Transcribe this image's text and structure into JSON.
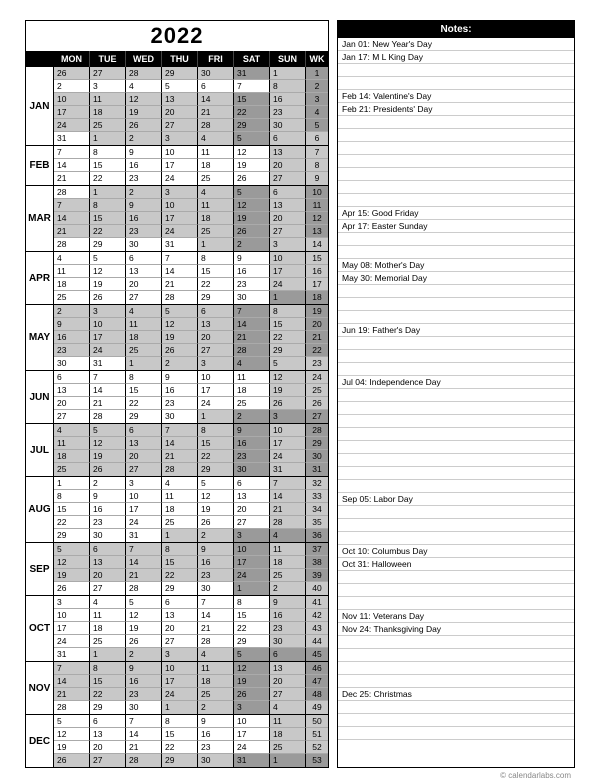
{
  "year": "2022",
  "day_headers": [
    "MON",
    "TUE",
    "WED",
    "THU",
    "FRI",
    "SAT",
    "SUN",
    "WK"
  ],
  "notes_header": "Notes:",
  "footer": "© calendarlabs.com",
  "months": [
    {
      "label": "JAN",
      "weeks": [
        {
          "d": [
            26,
            27,
            28,
            29,
            30,
            31,
            1
          ],
          "wk": 1,
          "gd": [
            0,
            1,
            2,
            3,
            4
          ],
          "gw": true,
          "gwk": true,
          "dw": [
            5
          ]
        },
        {
          "d": [
            2,
            3,
            4,
            5,
            6,
            7,
            8
          ],
          "wk": 2,
          "gd": [],
          "gw": true,
          "gwk": true,
          "dw": []
        },
        {
          "d": [
            10,
            11,
            12,
            13,
            14,
            15,
            16
          ],
          "wk": 3,
          "gd": [
            0,
            1,
            2,
            3,
            4
          ],
          "gw": true,
          "gwk": true,
          "dw": [
            5
          ]
        },
        {
          "d": [
            17,
            18,
            19,
            20,
            21,
            22,
            23
          ],
          "wk": 4,
          "gd": [
            0,
            1,
            2,
            3,
            4
          ],
          "gw": true,
          "gwk": true,
          "dw": [
            5
          ]
        },
        {
          "d": [
            24,
            25,
            26,
            27,
            28,
            29,
            30
          ],
          "wk": 5,
          "gd": [
            0,
            1,
            2,
            3,
            4
          ],
          "gw": true,
          "gwk": true,
          "dw": [
            5
          ]
        },
        {
          "d": [
            31,
            1,
            2,
            3,
            4,
            5,
            6
          ],
          "wk": 6,
          "gd": [
            1,
            2,
            3,
            4
          ],
          "gw": true,
          "gwk": false,
          "dw": [
            5
          ]
        }
      ]
    },
    {
      "label": "FEB",
      "weeks": [
        {
          "d": [
            7,
            8,
            9,
            10,
            11,
            12,
            13
          ],
          "wk": 7,
          "gd": [],
          "gw": true,
          "gwk": false,
          "dw": []
        },
        {
          "d": [
            14,
            15,
            16,
            17,
            18,
            19,
            20
          ],
          "wk": 8,
          "gd": [],
          "gw": true,
          "gwk": false,
          "dw": []
        },
        {
          "d": [
            21,
            22,
            23,
            24,
            25,
            26,
            27
          ],
          "wk": 9,
          "gd": [],
          "gw": true,
          "gwk": false,
          "dw": []
        }
      ]
    },
    {
      "label": "MAR",
      "weeks": [
        {
          "d": [
            28,
            1,
            2,
            3,
            4,
            5,
            6
          ],
          "wk": 10,
          "gd": [
            1,
            2,
            3,
            4
          ],
          "gw": true,
          "gwk": true,
          "dw": [
            5
          ]
        },
        {
          "d": [
            7,
            8,
            9,
            10,
            11,
            12,
            13
          ],
          "wk": 11,
          "gd": [
            0,
            1,
            2,
            3,
            4
          ],
          "gw": true,
          "gwk": true,
          "dw": [
            5
          ]
        },
        {
          "d": [
            14,
            15,
            16,
            17,
            18,
            19,
            20
          ],
          "wk": 12,
          "gd": [
            0,
            1,
            2,
            3,
            4
          ],
          "gw": true,
          "gwk": true,
          "dw": [
            5
          ]
        },
        {
          "d": [
            21,
            22,
            23,
            24,
            25,
            26,
            27
          ],
          "wk": 13,
          "gd": [
            0,
            1,
            2,
            3,
            4
          ],
          "gw": true,
          "gwk": true,
          "dw": [
            5
          ]
        },
        {
          "d": [
            28,
            29,
            30,
            31,
            1,
            2,
            3
          ],
          "wk": 14,
          "gd": [
            4
          ],
          "gw": true,
          "gwk": false,
          "dw": [
            5
          ]
        }
      ]
    },
    {
      "label": "APR",
      "weeks": [
        {
          "d": [
            4,
            5,
            6,
            7,
            8,
            9,
            10
          ],
          "wk": 15,
          "gd": [],
          "gw": true,
          "gwk": false,
          "dw": []
        },
        {
          "d": [
            11,
            12,
            13,
            14,
            15,
            16,
            17
          ],
          "wk": 16,
          "gd": [],
          "gw": true,
          "gwk": false,
          "dw": []
        },
        {
          "d": [
            18,
            19,
            20,
            21,
            22,
            23,
            24
          ],
          "wk": 17,
          "gd": [],
          "gw": true,
          "gwk": false,
          "dw": []
        },
        {
          "d": [
            25,
            26,
            27,
            28,
            29,
            30,
            1
          ],
          "wk": 18,
          "gd": [],
          "gw": true,
          "gwk": true,
          "dw": [
            6
          ]
        }
      ]
    },
    {
      "label": "MAY",
      "weeks": [
        {
          "d": [
            2,
            3,
            4,
            5,
            6,
            7,
            8
          ],
          "wk": 19,
          "gd": [
            0,
            1,
            2,
            3,
            4
          ],
          "gw": true,
          "gwk": true,
          "dw": [
            5
          ]
        },
        {
          "d": [
            9,
            10,
            11,
            12,
            13,
            14,
            15
          ],
          "wk": 20,
          "gd": [
            0,
            1,
            2,
            3,
            4
          ],
          "gw": true,
          "gwk": true,
          "dw": [
            5
          ]
        },
        {
          "d": [
            16,
            17,
            18,
            19,
            20,
            21,
            22
          ],
          "wk": 21,
          "gd": [
            0,
            1,
            2,
            3,
            4
          ],
          "gw": true,
          "gwk": true,
          "dw": [
            5
          ]
        },
        {
          "d": [
            23,
            24,
            25,
            26,
            27,
            28,
            29
          ],
          "wk": 22,
          "gd": [
            0,
            1,
            2,
            3,
            4
          ],
          "gw": true,
          "gwk": true,
          "dw": [
            5
          ]
        },
        {
          "d": [
            30,
            31,
            1,
            2,
            3,
            4,
            5
          ],
          "wk": 23,
          "gd": [
            2,
            3,
            4
          ],
          "gw": true,
          "gwk": false,
          "dw": [
            5
          ]
        }
      ]
    },
    {
      "label": "JUN",
      "weeks": [
        {
          "d": [
            6,
            7,
            8,
            9,
            10,
            11,
            12
          ],
          "wk": 24,
          "gd": [],
          "gw": true,
          "gwk": false,
          "dw": []
        },
        {
          "d": [
            13,
            14,
            15,
            16,
            17,
            18,
            19
          ],
          "wk": 25,
          "gd": [],
          "gw": true,
          "gwk": false,
          "dw": []
        },
        {
          "d": [
            20,
            21,
            22,
            23,
            24,
            25,
            26
          ],
          "wk": 26,
          "gd": [],
          "gw": true,
          "gwk": false,
          "dw": []
        },
        {
          "d": [
            27,
            28,
            29,
            30,
            1,
            2,
            3
          ],
          "wk": 27,
          "gd": [
            4
          ],
          "gw": true,
          "gwk": true,
          "dw": [
            5,
            6
          ]
        }
      ]
    },
    {
      "label": "JUL",
      "weeks": [
        {
          "d": [
            4,
            5,
            6,
            7,
            8,
            9,
            10
          ],
          "wk": 28,
          "gd": [
            0,
            1,
            2,
            3,
            4
          ],
          "gw": true,
          "gwk": true,
          "dw": [
            5
          ]
        },
        {
          "d": [
            11,
            12,
            13,
            14,
            15,
            16,
            17
          ],
          "wk": 29,
          "gd": [
            0,
            1,
            2,
            3,
            4
          ],
          "gw": true,
          "gwk": true,
          "dw": [
            5
          ]
        },
        {
          "d": [
            18,
            19,
            20,
            21,
            22,
            23,
            24
          ],
          "wk": 30,
          "gd": [
            0,
            1,
            2,
            3,
            4
          ],
          "gw": true,
          "gwk": true,
          "dw": [
            5
          ]
        },
        {
          "d": [
            25,
            26,
            27,
            28,
            29,
            30,
            31
          ],
          "wk": 31,
          "gd": [
            0,
            1,
            2,
            3,
            4
          ],
          "gw": true,
          "gwk": true,
          "dw": [
            5
          ]
        }
      ]
    },
    {
      "label": "AUG",
      "weeks": [
        {
          "d": [
            1,
            2,
            3,
            4,
            5,
            6,
            7
          ],
          "wk": 32,
          "gd": [],
          "gw": true,
          "gwk": false,
          "dw": []
        },
        {
          "d": [
            8,
            9,
            10,
            11,
            12,
            13,
            14
          ],
          "wk": 33,
          "gd": [],
          "gw": true,
          "gwk": false,
          "dw": []
        },
        {
          "d": [
            15,
            16,
            17,
            18,
            19,
            20,
            21
          ],
          "wk": 34,
          "gd": [],
          "gw": true,
          "gwk": false,
          "dw": []
        },
        {
          "d": [
            22,
            23,
            24,
            25,
            26,
            27,
            28
          ],
          "wk": 35,
          "gd": [],
          "gw": true,
          "gwk": false,
          "dw": []
        },
        {
          "d": [
            29,
            30,
            31,
            1,
            2,
            3,
            4
          ],
          "wk": 36,
          "gd": [
            3,
            4
          ],
          "gw": true,
          "gwk": true,
          "dw": [
            5,
            6
          ]
        }
      ]
    },
    {
      "label": "SEP",
      "weeks": [
        {
          "d": [
            5,
            6,
            7,
            8,
            9,
            10,
            11
          ],
          "wk": 37,
          "gd": [
            0,
            1,
            2,
            3,
            4
          ],
          "gw": true,
          "gwk": true,
          "dw": [
            5
          ]
        },
        {
          "d": [
            12,
            13,
            14,
            15,
            16,
            17,
            18
          ],
          "wk": 38,
          "gd": [
            0,
            1,
            2,
            3,
            4
          ],
          "gw": true,
          "gwk": true,
          "dw": [
            5
          ]
        },
        {
          "d": [
            19,
            20,
            21,
            22,
            23,
            24,
            25
          ],
          "wk": 39,
          "gd": [
            0,
            1,
            2,
            3,
            4
          ],
          "gw": true,
          "gwk": true,
          "dw": [
            5
          ]
        },
        {
          "d": [
            26,
            27,
            28,
            29,
            30,
            1,
            2
          ],
          "wk": 40,
          "gd": [],
          "gw": true,
          "gwk": false,
          "dw": [
            5
          ]
        }
      ]
    },
    {
      "label": "OCT",
      "weeks": [
        {
          "d": [
            3,
            4,
            5,
            6,
            7,
            8,
            9
          ],
          "wk": 41,
          "gd": [],
          "gw": true,
          "gwk": false,
          "dw": []
        },
        {
          "d": [
            10,
            11,
            12,
            13,
            14,
            15,
            16
          ],
          "wk": 42,
          "gd": [],
          "gw": true,
          "gwk": false,
          "dw": []
        },
        {
          "d": [
            17,
            18,
            19,
            20,
            21,
            22,
            23
          ],
          "wk": 43,
          "gd": [],
          "gw": true,
          "gwk": false,
          "dw": []
        },
        {
          "d": [
            24,
            25,
            26,
            27,
            28,
            29,
            30
          ],
          "wk": 44,
          "gd": [],
          "gw": true,
          "gwk": false,
          "dw": []
        },
        {
          "d": [
            31,
            1,
            2,
            3,
            4,
            5,
            6
          ],
          "wk": 45,
          "gd": [
            1,
            2,
            3,
            4
          ],
          "gw": true,
          "gwk": true,
          "dw": [
            5,
            6
          ]
        }
      ]
    },
    {
      "label": "NOV",
      "weeks": [
        {
          "d": [
            7,
            8,
            9,
            10,
            11,
            12,
            13
          ],
          "wk": 46,
          "gd": [
            0,
            1,
            2,
            3,
            4
          ],
          "gw": true,
          "gwk": true,
          "dw": [
            5
          ]
        },
        {
          "d": [
            14,
            15,
            16,
            17,
            18,
            19,
            20
          ],
          "wk": 47,
          "gd": [
            0,
            1,
            2,
            3,
            4
          ],
          "gw": true,
          "gwk": true,
          "dw": [
            5
          ]
        },
        {
          "d": [
            21,
            22,
            23,
            24,
            25,
            26,
            27
          ],
          "wk": 48,
          "gd": [
            0,
            1,
            2,
            3,
            4
          ],
          "gw": true,
          "gwk": true,
          "dw": [
            5
          ]
        },
        {
          "d": [
            28,
            29,
            30,
            1,
            2,
            3,
            4
          ],
          "wk": 49,
          "gd": [
            3,
            4
          ],
          "gw": true,
          "gwk": false,
          "dw": [
            5
          ]
        }
      ]
    },
    {
      "label": "DEC",
      "weeks": [
        {
          "d": [
            5,
            6,
            7,
            8,
            9,
            10,
            11
          ],
          "wk": 50,
          "gd": [],
          "gw": true,
          "gwk": false,
          "dw": []
        },
        {
          "d": [
            12,
            13,
            14,
            15,
            16,
            17,
            18
          ],
          "wk": 51,
          "gd": [],
          "gw": true,
          "gwk": false,
          "dw": []
        },
        {
          "d": [
            19,
            20,
            21,
            22,
            23,
            24,
            25
          ],
          "wk": 52,
          "gd": [],
          "gw": true,
          "gwk": false,
          "dw": []
        },
        {
          "d": [
            26,
            27,
            28,
            29,
            30,
            31,
            1
          ],
          "wk": 53,
          "gd": [
            0,
            1,
            2,
            3,
            4
          ],
          "gw": true,
          "gwk": true,
          "dw": [
            5,
            6
          ]
        }
      ]
    }
  ],
  "notes": [
    "Jan 01: New Year's Day",
    "Jan 17: M L King Day",
    "",
    "",
    "Feb 14: Valentine's Day",
    "Feb 21: Presidents' Day",
    "",
    "",
    "",
    "",
    "",
    "",
    "",
    "Apr 15: Good Friday",
    "Apr 17: Easter Sunday",
    "",
    "",
    "May 08: Mother's Day",
    "May 30: Memorial Day",
    "",
    "",
    "",
    "Jun 19: Father's Day",
    "",
    "",
    "",
    "Jul 04: Independence Day",
    "",
    "",
    "",
    "",
    "",
    "",
    "",
    "",
    "Sep 05: Labor Day",
    "",
    "",
    "",
    "Oct 10: Columbus Day",
    "Oct 31: Halloween",
    "",
    "",
    "",
    "Nov 11: Veterans Day",
    "Nov 24: Thanksgiving Day",
    "",
    "",
    "",
    "",
    "Dec 25: Christmas",
    "",
    "",
    ""
  ]
}
